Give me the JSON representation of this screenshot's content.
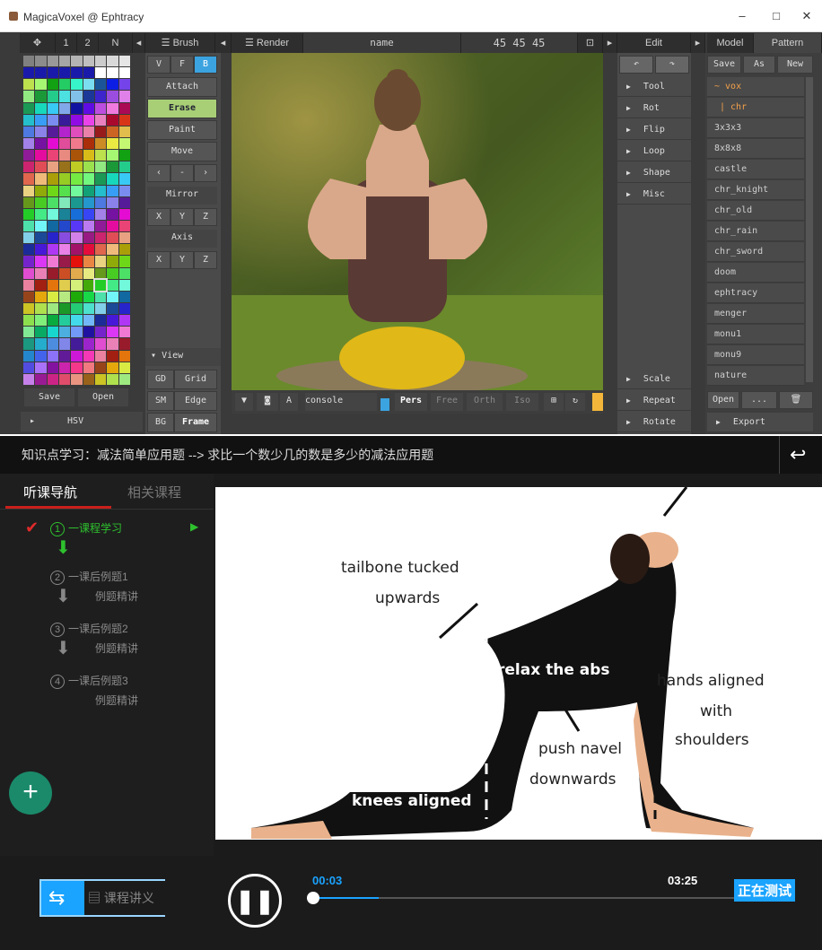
{
  "magicavoxel": {
    "window_title": "MagicaVoxel @ Ephtracy",
    "window_controls": {
      "minimize": "–",
      "maximize": "□",
      "close": "✕"
    },
    "palette_tabs": [
      "1",
      "2",
      "N"
    ],
    "brush_header": "☰ Brush",
    "brush_modes": [
      "V",
      "F",
      "B"
    ],
    "brush_actions": [
      "Attach",
      "Erase",
      "Paint",
      "Move"
    ],
    "brush_arrows": [
      "‹",
      "-",
      "›"
    ],
    "mirror_label": "Mirror",
    "axis_label": "Axis",
    "xyz": [
      "X",
      "Y",
      "Z"
    ],
    "view_label": "View",
    "view_buttons": [
      [
        "GD",
        "Grid"
      ],
      [
        "SM",
        "Edge"
      ],
      [
        "BG",
        "Frame"
      ]
    ],
    "palette_buttons": [
      "Save",
      "Open"
    ],
    "hsv_label": "HSV",
    "render_header": "☰ Render",
    "name_label": "name",
    "dims": "45 45 45",
    "viewport_bar": {
      "console": "console",
      "modes": [
        "Pers",
        "Free",
        "Orth",
        "Iso"
      ],
      "a": "A"
    },
    "edit_header": "Edit",
    "edit_items": [
      "Tool",
      "Rot",
      "Flip",
      "Loop",
      "Shape",
      "Misc"
    ],
    "edit_bottom": [
      "Scale",
      "Repeat",
      "Rotate"
    ],
    "model_tabs": [
      "Model",
      "Pattern"
    ],
    "file_buttons": [
      "Save",
      "As",
      "New"
    ],
    "model_list": [
      "~ vox",
      "| chr",
      "3x3x3",
      "8x8x8",
      "castle",
      "chr_knight",
      "chr_old",
      "chr_rain",
      "chr_sword",
      "doom",
      "ephtracy",
      "menger",
      "monu1",
      "monu9",
      "nature"
    ],
    "model_bottom": [
      "Open",
      "...",
      "🗑"
    ],
    "export_label": "Export"
  },
  "lesson": {
    "title": "知识点学习：减法简单应用题 --> 求比一个数少几的数是多少的减法应用题",
    "tabs": [
      "听课导航",
      "相关课程"
    ],
    "steps": [
      {
        "num": "1",
        "label": "一课程学习",
        "sub": ""
      },
      {
        "num": "2",
        "label": "一课后例题1",
        "sub": "例题精讲"
      },
      {
        "num": "3",
        "label": "一课后例题2",
        "sub": "例题精讲"
      },
      {
        "num": "4",
        "label": "一课后例题3",
        "sub": "例题精讲"
      }
    ],
    "annotations": [
      "tailbone tucked",
      "upwards",
      "relax the abs",
      "hands aligned",
      "with",
      "shoulders",
      "push navel",
      "downwards",
      "knees aligned"
    ],
    "notes_button": "课程讲义",
    "time_current": "00:03",
    "time_total": "03:25",
    "progress": 0.015,
    "testing_badge": "正在测试",
    "colors": {
      "accent_green": "#2ec12e",
      "accent_blue": "#1aa3ff",
      "fab": "#1a8a6a"
    }
  }
}
